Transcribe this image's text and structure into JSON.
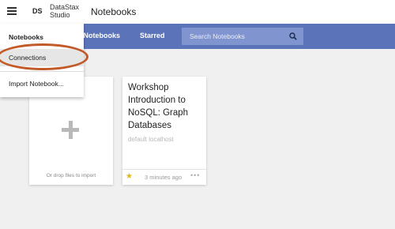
{
  "header": {
    "logo_text": "DS",
    "brand_line1": "DataStax",
    "brand_line2": "Studio",
    "title": "Notebooks"
  },
  "nav": {
    "tabs": [
      {
        "label": "ll Notebooks"
      },
      {
        "label": "Starred"
      }
    ],
    "search_placeholder": "Search Notebooks"
  },
  "menu": {
    "items": [
      {
        "label": "Notebooks"
      },
      {
        "label": "Connections"
      },
      {
        "label": "Import Notebook..."
      }
    ],
    "highlight_color": "#c15a26"
  },
  "cards": {
    "import": {
      "label": "Or drop files to import"
    },
    "notebook": {
      "title": "Workshop Introduction to NoSQL: Graph Databases",
      "connection": "default localhost",
      "updated": "3 minutes ago",
      "more": "•••"
    }
  },
  "colors": {
    "nav_bar": "#5b73b9",
    "star": "#e3b51c"
  }
}
